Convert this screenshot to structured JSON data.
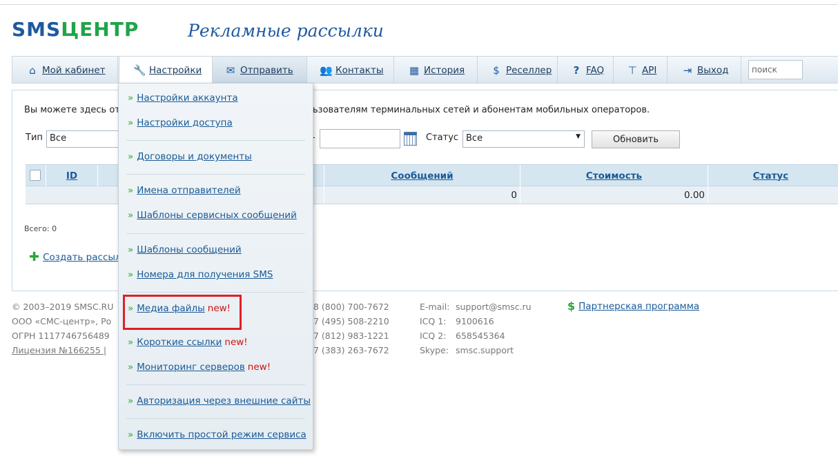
{
  "brand": {
    "logo_sms": "SMS",
    "logo_center": "ЦЕНТР",
    "title": "Рекламные рассылки"
  },
  "nav": {
    "items": [
      {
        "id": "cabinet",
        "icon": "home-icon",
        "label": "Мой кабинет"
      },
      {
        "id": "settings",
        "icon": "tools-icon",
        "label": "Настройки"
      },
      {
        "id": "send",
        "icon": "envelope-icon",
        "label": "Отправить"
      },
      {
        "id": "contacts",
        "icon": "people-icon",
        "label": "Контакты"
      },
      {
        "id": "history",
        "icon": "calendar-icon",
        "label": "История"
      },
      {
        "id": "reseller",
        "icon": "dollar-icon",
        "label": "Реселлер"
      },
      {
        "id": "faq",
        "icon": "question-icon",
        "label": "FAQ"
      },
      {
        "id": "api",
        "icon": "sitemap-icon",
        "label": "API"
      },
      {
        "id": "logout",
        "icon": "exit-icon",
        "label": "Выход"
      }
    ],
    "search_value": "поиск"
  },
  "main": {
    "desc_left": "Вы можете здесь от",
    "desc_right": "ьзователям терминальных сетей и абонентам мобильных операторов.",
    "filter_type_label": "Тип",
    "filter_type_value": "Все",
    "date_dash": "-",
    "filter_status_label": "Статус",
    "filter_status_value": "Все",
    "refresh_button": "Обновить",
    "table": {
      "headers": {
        "id": "ID",
        "messages": "Сообщений",
        "cost": "Стоимость",
        "status": "Статус"
      },
      "totals": {
        "messages": "0",
        "cost": "0.00"
      }
    },
    "total_label": "Всего: 0",
    "create_label": "Создать рассыл"
  },
  "footer": {
    "col1": [
      "© 2003–2019 SMSC.RU",
      "ООО «СМС-центр», Ро",
      "ОГРН 1117746756489",
      "Лицензия №166255 | "
    ],
    "phones": [
      "8 (800) 700-7672",
      "7 (495) 508-2210",
      "7 (812) 983-1221",
      "7 (383) 263-7672"
    ],
    "contact_labels": [
      "E-mail:",
      "ICQ 1:",
      "ICQ 2:",
      "Skype:"
    ],
    "contact_values": [
      "support@smsc.ru",
      "9100616",
      "658545364",
      "smsc.support"
    ],
    "partner_label": "Партнерская программа"
  },
  "dropdown": {
    "items": [
      {
        "label": "Настройки аккаунта",
        "new": ""
      },
      {
        "label": "Настройки доступа",
        "new": ""
      },
      {
        "label": "Договоры и документы",
        "new": ""
      },
      {
        "label": "Имена отправителей",
        "new": ""
      },
      {
        "label": "Шаблоны сервисных сообщений",
        "new": ""
      },
      {
        "label": "Шаблоны сообщений",
        "new": ""
      },
      {
        "label": "Номера для получения SMS",
        "new": ""
      },
      {
        "label": "Медиа файлы",
        "new": "new!"
      },
      {
        "label": "Короткие ссылки",
        "new": "new!"
      },
      {
        "label": "Мониторинг серверов",
        "new": "new!"
      },
      {
        "label": "Авторизация через внешние сайты",
        "new": ""
      },
      {
        "label": "Включить простой режим сервиса",
        "new": ""
      }
    ]
  },
  "colors": {
    "brand_blue": "#1f5aa0",
    "brand_green": "#1fa44a",
    "link": "#1a5a96",
    "new_red": "#d01010",
    "highlight": "#e01f25"
  }
}
